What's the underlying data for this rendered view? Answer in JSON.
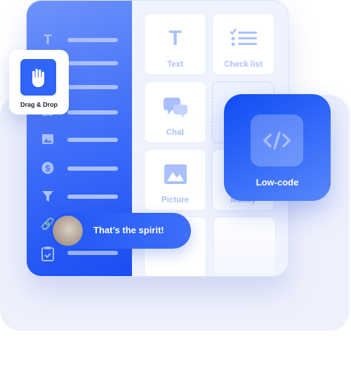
{
  "sidebar": {
    "icons": [
      "text-icon",
      "hand-icon",
      "list-icon",
      "number-icon",
      "image-icon",
      "dollar-icon",
      "filter-icon",
      "link-icon",
      "clipboard-icon"
    ]
  },
  "tiles": [
    {
      "label": "Text",
      "icon": "text-icon"
    },
    {
      "label": "Check list",
      "icon": "checklist-icon"
    },
    {
      "label": "Chat",
      "icon": "chat-icon"
    },
    {
      "label": "Picture",
      "icon": "picture-icon"
    },
    {
      "label": "Money",
      "icon": "money-icon"
    }
  ],
  "drag_drop": {
    "label": "Drag & Drop",
    "icon": "hand-icon"
  },
  "low_code": {
    "label": "Low-code",
    "icon": "code-icon"
  },
  "chat_bubble": {
    "text": "That’s the spirit!"
  },
  "colors": {
    "accent": "#2f66f7",
    "light": "#a9c0fd",
    "background": "#eef1fc"
  }
}
